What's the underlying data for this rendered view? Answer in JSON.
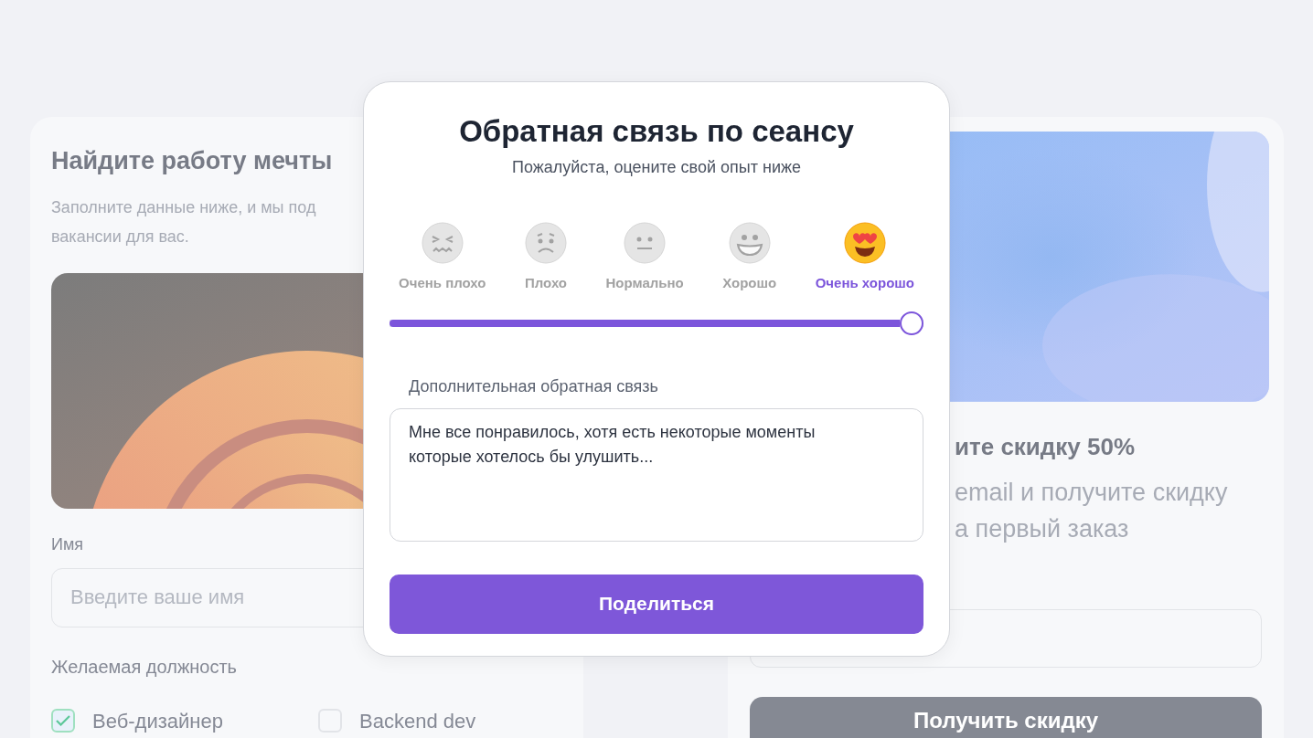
{
  "job_card": {
    "title": "Найдите работу мечты",
    "description_lines": [
      "Заполните данные ниже, и мы под",
      "вакансии для вас."
    ],
    "name_label": "Имя",
    "name_placeholder": "Введите ваше имя",
    "position_label": "Желаемая должность",
    "positions": [
      {
        "label": "Веб-дизайнер",
        "checked": true
      },
      {
        "label": "Backend dev",
        "checked": false
      }
    ]
  },
  "discount_card": {
    "title": "ите скидку 50%",
    "description_lines": [
      "email и получите скидку",
      "а первый заказ"
    ],
    "button": "Получить скидку"
  },
  "feedback_dialog": {
    "title": "Обратная связь по сеансу",
    "subtitle": "Пожалуйста, оцените свой опыт ниже",
    "ratings": [
      {
        "label": "Очень плохо",
        "selected": false
      },
      {
        "label": "Плохо",
        "selected": false
      },
      {
        "label": "Нормально",
        "selected": false
      },
      {
        "label": "Хорошо",
        "selected": false
      },
      {
        "label": "Очень хорошо",
        "selected": true
      }
    ],
    "slider": {
      "level": 1
    },
    "comment_label": "Дополнительная обратная связь",
    "comment": "Мне все понравилось, хотя есть некоторые моменты которые хотелось бы улушить...",
    "submit": "Поделиться"
  }
}
